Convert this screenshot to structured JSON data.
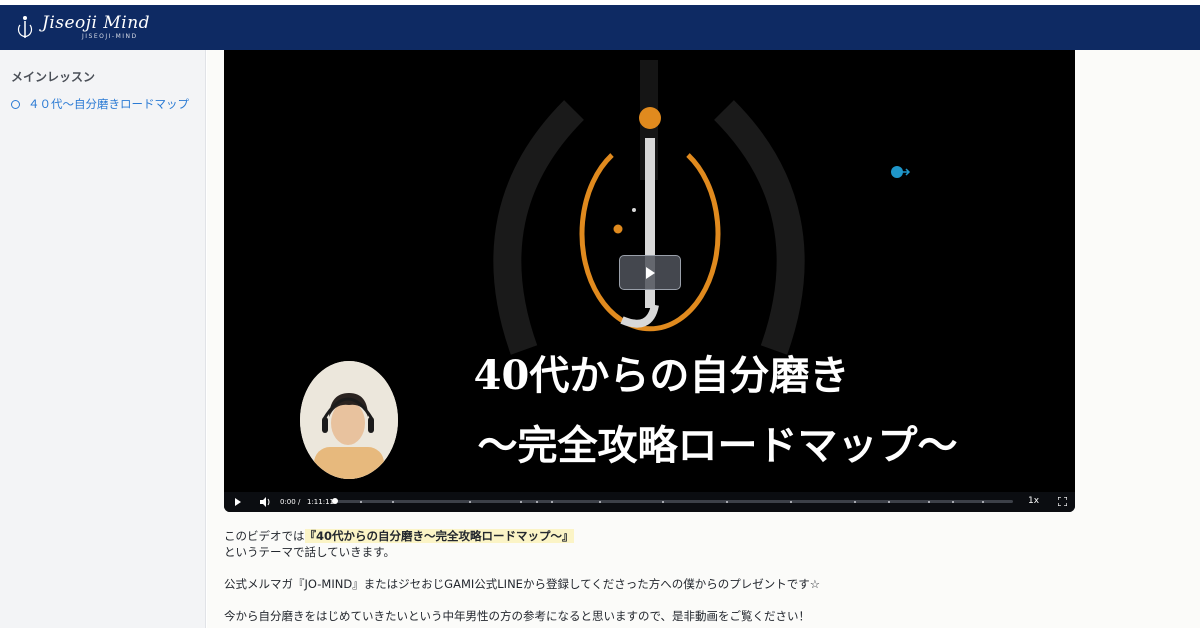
{
  "brand": {
    "name": "Jiseoji Mind",
    "sub": "JISEOJI-MIND"
  },
  "sidebar": {
    "title": "メインレッスン",
    "items": [
      {
        "label": "４０代～自分磨きロードマップ"
      }
    ]
  },
  "video": {
    "title_line1": "40代からの自分磨き",
    "title_line2": "～完全攻略ロードマップ～",
    "current_time": "0:00",
    "separator": "/",
    "duration": "1:11:11",
    "speed": "1x",
    "progress": 0
  },
  "description": {
    "line1_prefix": "このビデオでは",
    "line1_highlight": "『40代からの自分磨き～完全攻略ロードマップ～』",
    "line2": "というテーマで話していきます。",
    "line3": "公式メルマガ『JO-MIND』またはジセおじGAMI公式LINEから登録してくださった方への僕からのプレゼントです☆",
    "line4": "今から自分磨きをはじめていきたいという中年男性の方の参考になると思いますので、是非動画をご覧ください！"
  },
  "colors": {
    "header": "#0e2a63",
    "accent": "#2a7ad4",
    "logo_orange": "#e08a1e"
  }
}
